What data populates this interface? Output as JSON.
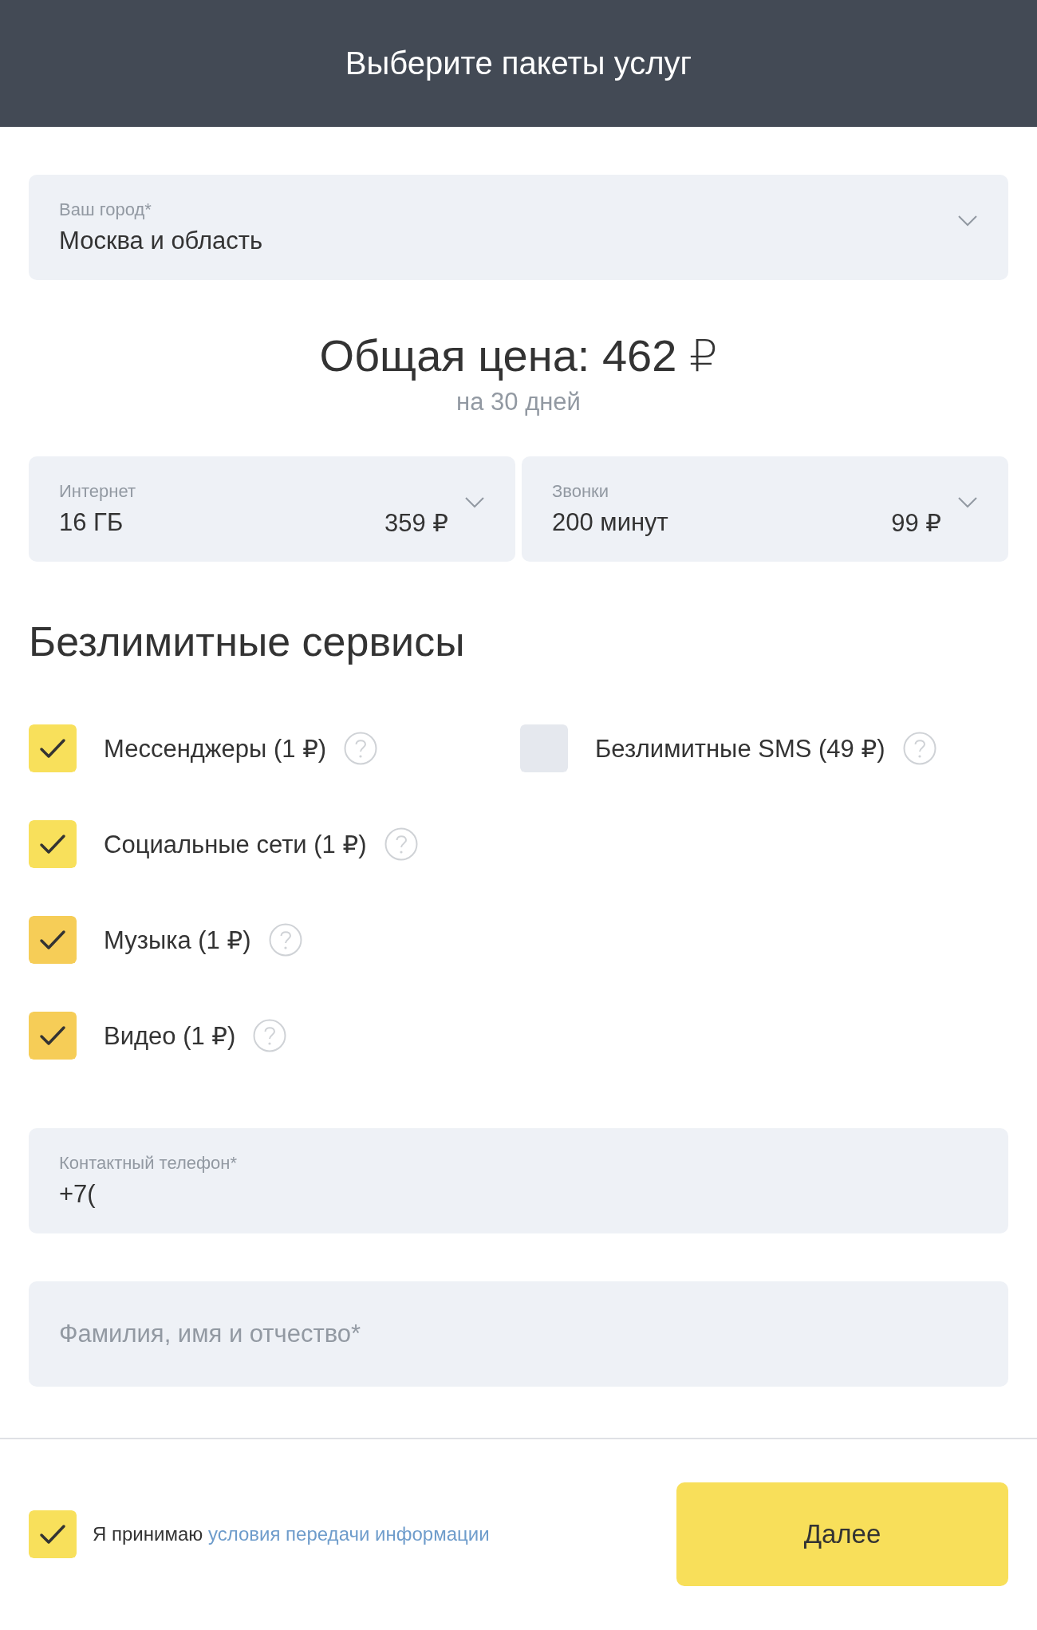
{
  "header": {
    "title": "Выберите пакеты услуг"
  },
  "city": {
    "label": "Ваш город*",
    "value": "Москва и область"
  },
  "total": {
    "price": "Общая цена: 462 ₽",
    "period": "на 30 дней"
  },
  "packages": [
    {
      "label": "Интернет",
      "value": "16 ГБ",
      "price": "359 ₽"
    },
    {
      "label": "Звонки",
      "value": "200 минут",
      "price": "99 ₽"
    }
  ],
  "services": {
    "title": "Безлимитные сервисы",
    "columns": [
      {
        "items": [
          {
            "label": "Мессенджеры (1 ₽)",
            "checked": true,
            "color": "#f8e05b"
          },
          {
            "label": "Социальные сети (1 ₽)",
            "checked": true,
            "color": "#f8e05b"
          },
          {
            "label": "Музыка (1 ₽)",
            "checked": true,
            "color": "#f6cd57"
          },
          {
            "label": "Видео (1 ₽)",
            "checked": true,
            "color": "#f6cd57"
          }
        ]
      },
      {
        "items": [
          {
            "label": "Безлимитные SMS (49 ₽)",
            "checked": false,
            "color": "#e5e8ee"
          }
        ]
      }
    ]
  },
  "phone": {
    "label": "Контактный телефон*",
    "value": "+7("
  },
  "name": {
    "placeholder": "Фамилия, имя и отчество*"
  },
  "footer": {
    "agree": {
      "checked": true,
      "text": "Я принимаю",
      "link": "условия передачи информации"
    },
    "button": "Далее"
  }
}
